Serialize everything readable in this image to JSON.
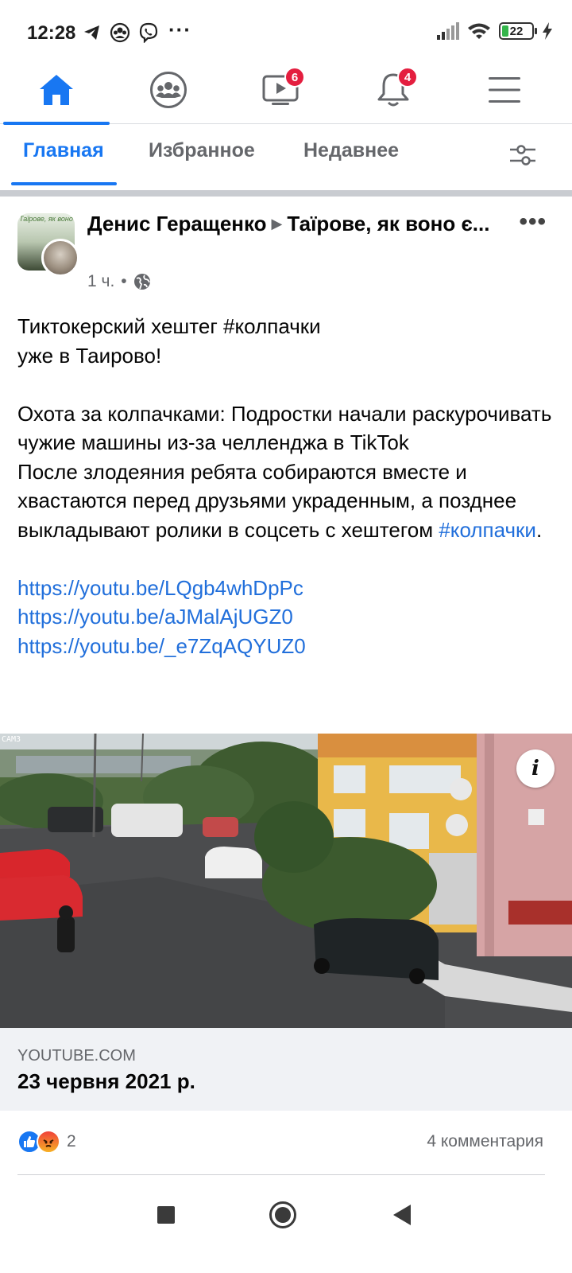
{
  "status_bar": {
    "time": "12:28",
    "battery_level": "22"
  },
  "top_nav": {
    "items": [
      {
        "name": "home",
        "badge": ""
      },
      {
        "name": "groups",
        "badge": ""
      },
      {
        "name": "watch",
        "badge": "6"
      },
      {
        "name": "notifications",
        "badge": "4"
      },
      {
        "name": "menu",
        "badge": ""
      }
    ],
    "active": "home",
    "accent_color": "#1877f2",
    "badge_color": "#e41e3f"
  },
  "feed_tabs": {
    "home": "Главная",
    "favorites": "Избранное",
    "recent": "Недавнее"
  },
  "post": {
    "author": "Денис Геращенко",
    "group": "Таїрове, як воно є...",
    "avatar_group_text": "Таїрове, як воно",
    "time": "1 ч.",
    "time_separator": "•",
    "privacy_icon": "globe-icon",
    "text_intro": "Тиктокерский хештег #колпачки\nуже в Таирово!",
    "text_main": "Охота за колпачками: Подростки  начали раскурочивать чужие машины из-за челленджа в TikTok\nПосле злодеяния ребята собираются вместе и хвастаются перед друзьями украденным, а позднее выкладывают ролики в соцсеть с хештегом ",
    "hashtag_link": "#колпачки",
    "text_end": ".",
    "links": [
      "https://youtu.be/LQgb4whDpPc",
      "https://youtu.be/aJMalAjUGZ0",
      "https://youtu.be/_e7ZqAQYUZ0"
    ],
    "image_cam_label": "CAM3",
    "link_preview": {
      "domain": "YOUTUBE.COM",
      "title": "23 червня 2021 р."
    },
    "reactions": {
      "count": "2",
      "types": [
        "like",
        "angry"
      ]
    },
    "comments": "4 комментария"
  }
}
